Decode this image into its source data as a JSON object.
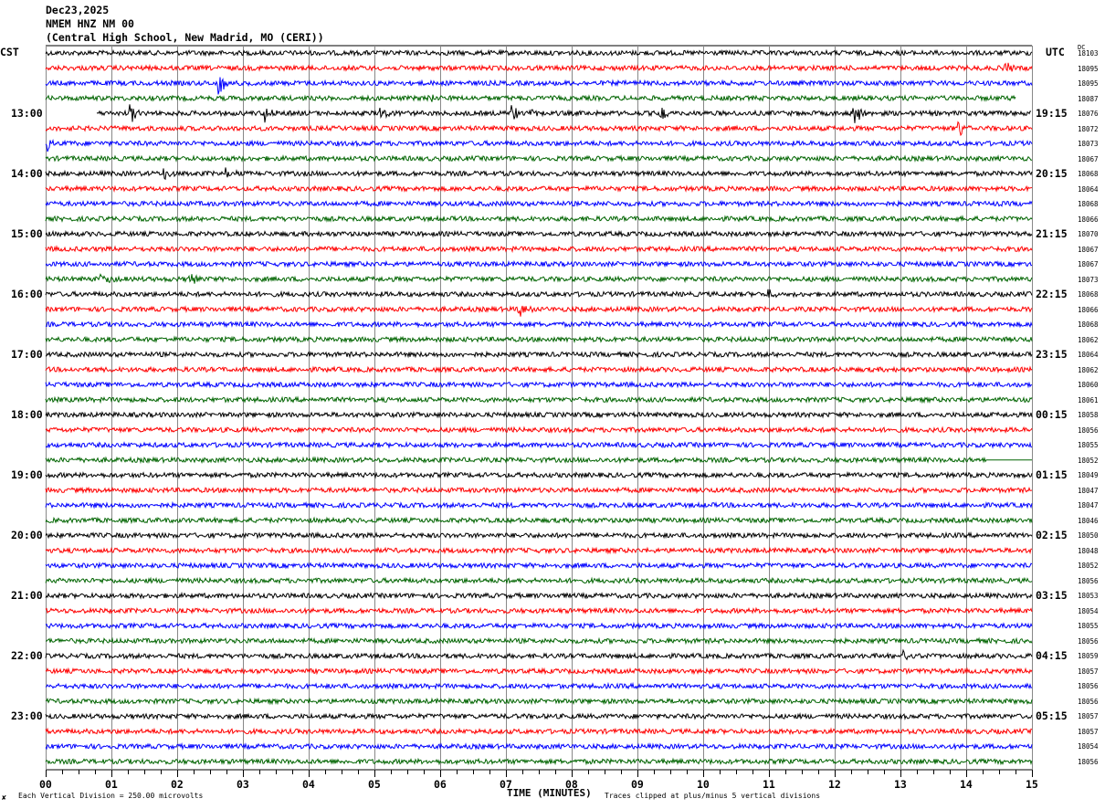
{
  "header": {
    "date": "Dec23,2025",
    "station": "NMEM HNZ NM 00",
    "location": "(Central High School, New Madrid, MO (CERI))"
  },
  "left_timezone": "CST",
  "right_timezone": "UTC",
  "dc_label": "DC",
  "footer": {
    "scale_note": "Each Vertical Division =  250.00 microvolts",
    "clip_note": "Traces clipped at plus/minus 5 vertical divisions",
    "corner_mark": "✘"
  },
  "chart_data": {
    "type": "line",
    "subtype": "helicorder",
    "xlabel": "TIME (MINUTES)",
    "x_ticks": [
      "00",
      "01",
      "02",
      "03",
      "04",
      "05",
      "06",
      "07",
      "08",
      "09",
      "10",
      "11",
      "12",
      "13",
      "14",
      "15"
    ],
    "xlim": [
      0,
      15
    ],
    "grid": "vertical lines each minute",
    "trace_colors": [
      "#000000",
      "#ff0000",
      "#0000ff",
      "#006400"
    ],
    "rows": 48,
    "left_hour_labels": [
      {
        "row": 4,
        "label": "13:00"
      },
      {
        "row": 8,
        "label": "14:00"
      },
      {
        "row": 12,
        "label": "15:00"
      },
      {
        "row": 16,
        "label": "16:00"
      },
      {
        "row": 20,
        "label": "17:00"
      },
      {
        "row": 24,
        "label": "18:00"
      },
      {
        "row": 28,
        "label": "19:00"
      },
      {
        "row": 32,
        "label": "20:00"
      },
      {
        "row": 36,
        "label": "21:00"
      },
      {
        "row": 40,
        "label": "22:00"
      },
      {
        "row": 44,
        "label": "23:00"
      }
    ],
    "right_hour_labels": [
      {
        "row": 4,
        "label": "19:15"
      },
      {
        "row": 8,
        "label": "20:15"
      },
      {
        "row": 12,
        "label": "21:15"
      },
      {
        "row": 16,
        "label": "22:15"
      },
      {
        "row": 20,
        "label": "23:15"
      },
      {
        "row": 24,
        "label": "00:15"
      },
      {
        "row": 28,
        "label": "01:15"
      },
      {
        "row": 32,
        "label": "02:15"
      },
      {
        "row": 36,
        "label": "03:15"
      },
      {
        "row": 40,
        "label": "04:15"
      },
      {
        "row": 44,
        "label": "05:15"
      }
    ],
    "dc_values": [
      "18103",
      "18095",
      "18095",
      "18087",
      "18076",
      "18072",
      "18073",
      "18067",
      "18068",
      "18064",
      "18068",
      "18066",
      "18070",
      "18067",
      "18067",
      "18073",
      "18068",
      "18066",
      "18068",
      "18062",
      "18064",
      "18062",
      "18060",
      "18061",
      "18058",
      "18056",
      "18055",
      "18052",
      "18049",
      "18047",
      "18047",
      "18046",
      "18050",
      "18048",
      "18052",
      "18056",
      "18053",
      "18054",
      "18055",
      "18056",
      "18059",
      "18057",
      "18056",
      "18056",
      "18057",
      "18057",
      "18054",
      "18056"
    ],
    "row_spans": [
      {
        "row": 3,
        "end": 14.75
      },
      {
        "row": 4,
        "start": 0.78
      },
      {
        "row": 27,
        "flat_from": 14.3
      }
    ],
    "events": [
      {
        "row": 1,
        "minute": 14.6,
        "amp": 6
      },
      {
        "row": 2,
        "minute": 2.65,
        "amp": 14
      },
      {
        "row": 3,
        "minute": 5.8,
        "amp": 5
      },
      {
        "row": 4,
        "minute": 1.3,
        "amp": 12
      },
      {
        "row": 4,
        "minute": 3.35,
        "amp": 11
      },
      {
        "row": 4,
        "minute": 5.1,
        "amp": 7
      },
      {
        "row": 4,
        "minute": 7.1,
        "amp": 12
      },
      {
        "row": 4,
        "minute": 7.4,
        "amp": 9
      },
      {
        "row": 4,
        "minute": 9.35,
        "amp": 9
      },
      {
        "row": 4,
        "minute": 12.3,
        "amp": 14
      },
      {
        "row": 5,
        "minute": 13.9,
        "amp": 9
      },
      {
        "row": 6,
        "minute": 0.05,
        "amp": 9
      },
      {
        "row": 8,
        "minute": 1.8,
        "amp": 8
      },
      {
        "row": 8,
        "minute": 2.75,
        "amp": 5
      },
      {
        "row": 15,
        "minute": 0.85,
        "amp": 9
      },
      {
        "row": 15,
        "minute": 2.2,
        "amp": 6
      },
      {
        "row": 16,
        "minute": 11.0,
        "amp": 7
      },
      {
        "row": 17,
        "minute": 7.2,
        "amp": 10
      },
      {
        "row": 40,
        "minute": 13.0,
        "amp": 11
      }
    ]
  }
}
